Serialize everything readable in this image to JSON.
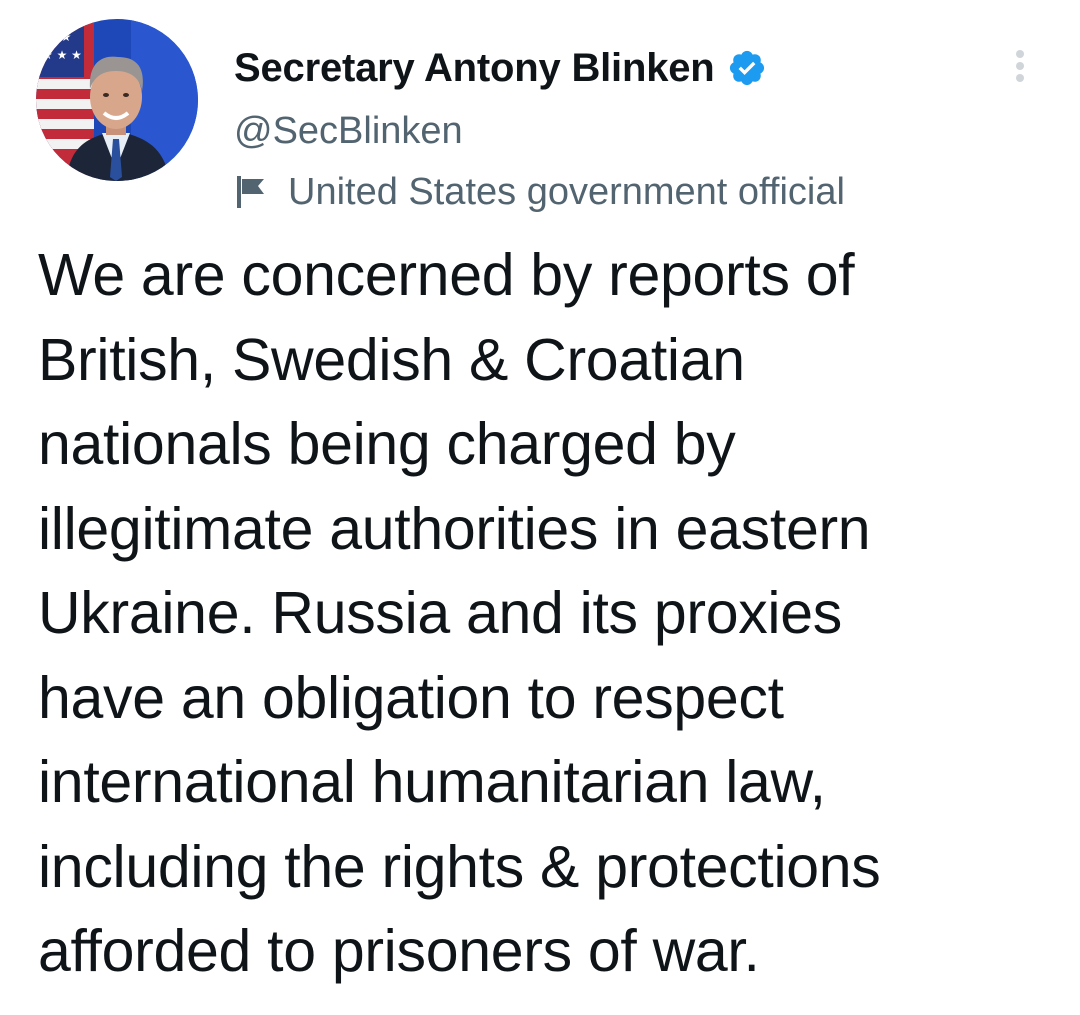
{
  "author": {
    "display_name": "Secretary Antony Blinken",
    "handle": "@SecBlinken",
    "label": "United States government official",
    "verified": true,
    "avatar_icon": "profile-photo",
    "verified_icon": "verified-badge-icon",
    "label_icon": "government-flag-icon"
  },
  "menu": {
    "icon": "more-vertical-icon"
  },
  "tweet": {
    "lines": [
      "We are concerned by reports of",
      "British, Swedish & Croatian",
      "nationals being charged by",
      "illegitimate authorities in eastern",
      "Ukraine. Russia and its proxies",
      "have an obligation to respect",
      "international humanitarian law,",
      "including the rights & protections",
      "afforded to prisoners of war."
    ]
  },
  "colors": {
    "text_primary": "#0f1419",
    "text_secondary": "#536471",
    "verified_blue": "#1d9bf0",
    "background": "#ffffff"
  }
}
